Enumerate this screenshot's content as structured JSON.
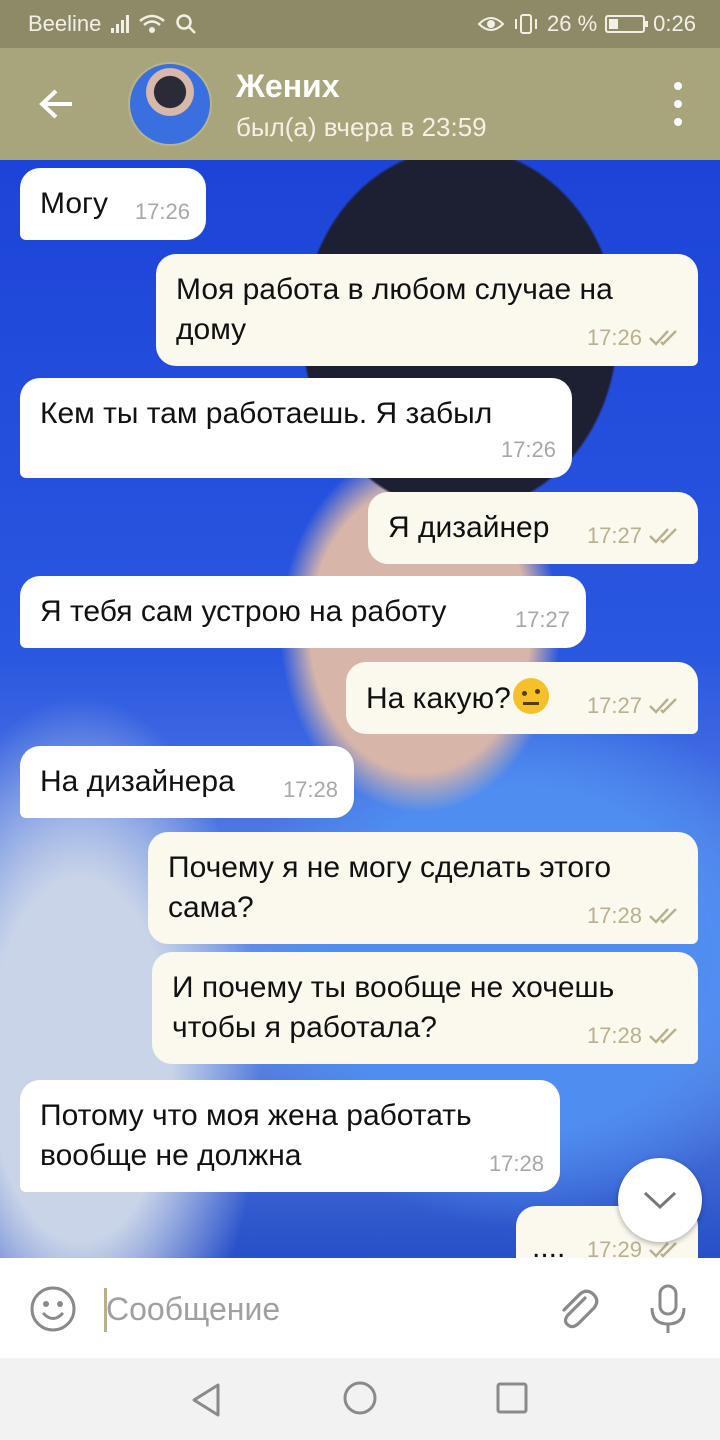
{
  "status_bar": {
    "carrier": "Beeline",
    "battery_percent": "26 %",
    "time": "0:26"
  },
  "header": {
    "contact_name": "Жених",
    "last_seen": "был(а) вчера в 23:59"
  },
  "messages": [
    {
      "direction": "in",
      "text": "Могу",
      "time": "17:26"
    },
    {
      "direction": "out",
      "text": "Моя работа в любом случае на дому",
      "time": "17:26",
      "read": true
    },
    {
      "direction": "in",
      "text": "Кем ты там работаешь. Я забыл",
      "time": "17:26"
    },
    {
      "direction": "out",
      "text": "Я дизайнер",
      "time": "17:27",
      "read": true
    },
    {
      "direction": "in",
      "text": "Я тебя сам устрою на работу",
      "time": "17:27"
    },
    {
      "direction": "out",
      "text": "На какую?",
      "emoji": "face-with-raised-eyebrow",
      "time": "17:27",
      "read": true
    },
    {
      "direction": "in",
      "text": "На дизайнера",
      "time": "17:28"
    },
    {
      "direction": "out",
      "text": "Почему я не могу сделать этого сама?",
      "time": "17:28",
      "read": true
    },
    {
      "direction": "out",
      "text": "И почему ты вообще не хочешь чтобы я работала?",
      "time": "17:28",
      "read": true
    },
    {
      "direction": "in",
      "text": "Потому что моя жена работать вообще не должна",
      "time": "17:28"
    },
    {
      "direction": "out",
      "text": "....",
      "time": "17:29",
      "read": true
    }
  ],
  "composer": {
    "placeholder": "Сообщение"
  },
  "colors": {
    "header_bg": "#a8a47c",
    "status_bg": "#8e8a68",
    "outgoing_bubble": "#fbf9ee",
    "incoming_bubble": "#ffffff",
    "tick_color": "#b9b08e"
  },
  "icons": {
    "back": "arrow-left-icon",
    "menu": "more-vertical-icon",
    "emoji": "smiley-icon",
    "attach": "paperclip-icon",
    "mic": "microphone-icon",
    "scroll": "chevron-down-icon",
    "nav_back": "triangle-back-icon",
    "nav_home": "circle-home-icon",
    "nav_recent": "square-recents-icon"
  }
}
